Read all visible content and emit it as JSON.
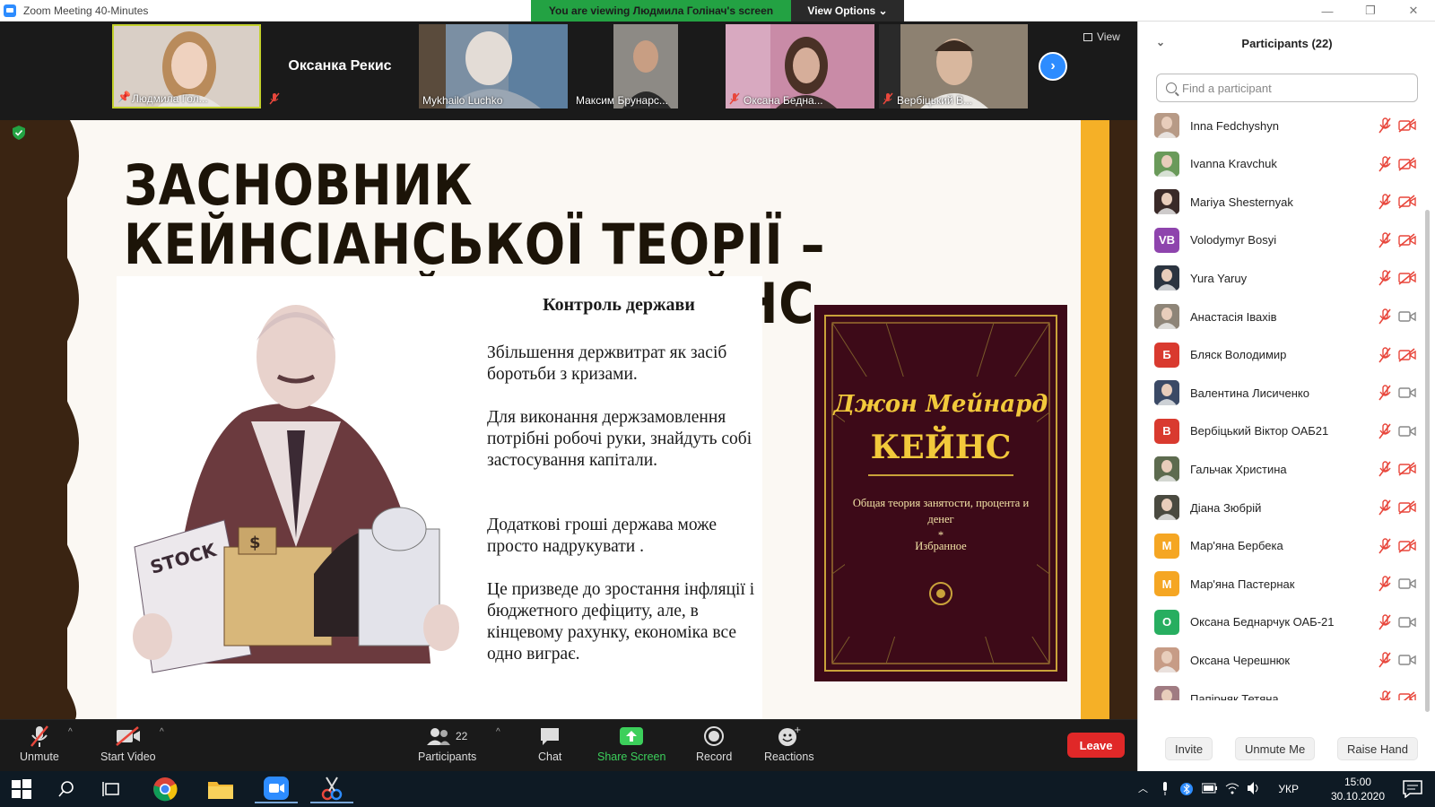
{
  "window": {
    "title": "Zoom Meeting 40-Minutes"
  },
  "banner": {
    "viewing": "You are viewing Людмила Голінач's screen",
    "view_options": "View Options ⌄"
  },
  "view_button": "View",
  "thumbnails": [
    {
      "label": "Людмила Гол...",
      "type": "video"
    },
    {
      "label": "Оксанка Рекис",
      "type": "name"
    },
    {
      "label": "Mykhailo Luchko",
      "type": "video"
    },
    {
      "label": "Максим Брунарс...",
      "type": "video"
    },
    {
      "label": "Оксана Бедна...",
      "type": "video"
    },
    {
      "label": "Вербіцький В...",
      "type": "video"
    }
  ],
  "slide": {
    "title_line1": "ЗАСНОВНИК КЕЙНСІАНСЬКОЇ ТЕОРІЇ –",
    "title_line2": "ДЖОН МЕЙНАРД КЕЙНС",
    "illustration_text": {
      "stock": "STOCK",
      "dollar": "$"
    },
    "heading": "Контроль держави",
    "paragraphs": [
      "Збільшення держвитрат як засіб боротьби з кризами.",
      "Для виконання держзамовлення потрібні робочі руки, знайдуть собі застосування капітали.",
      "Додаткові гроші держава може просто надрукувати .",
      "Це призведе до зростання інфляції і бюджетного дефіциту, але, в кінцевому рахунку, економіка все одно виграє."
    ],
    "book": {
      "author_line1": "Джон Мейнард",
      "author_line2": "КЕЙНС",
      "subtitle": "Общая теория занятости, процента и денег",
      "star": "*",
      "selected": "Избранное"
    }
  },
  "toolbar": {
    "unmute": "Unmute",
    "start_video": "Start Video",
    "participants": "Participants",
    "participants_count": "22",
    "chat": "Chat",
    "share_screen": "Share Screen",
    "record": "Record",
    "reactions": "Reactions",
    "leave": "Leave"
  },
  "panel": {
    "title": "Participants (22)",
    "search_placeholder": "Find a participant",
    "participants": [
      {
        "name": "Inna Fedchyshyn",
        "avatar": "photo",
        "color": "#b79a86",
        "video_on": false
      },
      {
        "name": "Ivanna Kravchuk",
        "avatar": "photo",
        "color": "#6a9a5a",
        "video_on": false
      },
      {
        "name": "Mariya Shesternyak",
        "avatar": "photo",
        "color": "#3a2a28",
        "video_on": false
      },
      {
        "name": "Volodymyr Bosyi",
        "avatar": "VB",
        "color": "#8e44ad",
        "video_on": false
      },
      {
        "name": "Yura Yaruy",
        "avatar": "photo",
        "color": "#2b3440",
        "video_on": false
      },
      {
        "name": "Анастасія Іваxів",
        "avatar": "photo",
        "color": "#8e8578",
        "video_on": true
      },
      {
        "name": "Бляск Володимир",
        "avatar": "Б",
        "color": "#d93a2f",
        "video_on": false
      },
      {
        "name": "Валентина Лисиченко",
        "avatar": "photo",
        "color": "#3b4a66",
        "video_on": true
      },
      {
        "name": "Вербіцький Віктор ОАБ21",
        "avatar": "В",
        "color": "#d93a2f",
        "video_on": true
      },
      {
        "name": "Гальчак Христина",
        "avatar": "photo",
        "color": "#5d6b4f",
        "video_on": false
      },
      {
        "name": "Діана Зюбрій",
        "avatar": "photo",
        "color": "#4a4a40",
        "video_on": false
      },
      {
        "name": "Мар'яна Бербека",
        "avatar": "М",
        "color": "#f5a623",
        "video_on": false
      },
      {
        "name": "Мар'яна Пастернак",
        "avatar": "М",
        "color": "#f5a623",
        "video_on": true
      },
      {
        "name": "Оксана Беднарчук ОАБ-21",
        "avatar": "О",
        "color": "#27ae60",
        "video_on": true
      },
      {
        "name": "Оксана Черешнюк",
        "avatar": "photo",
        "color": "#c79c86",
        "video_on": true
      },
      {
        "name": "Папірняк Тетяна",
        "avatar": "photo",
        "color": "#a07b82",
        "video_on": false
      }
    ],
    "invite": "Invite",
    "unmute_me": "Unmute Me",
    "raise_hand": "Raise Hand"
  },
  "taskbar": {
    "lang": "УКР",
    "time": "15:00",
    "date": "30.10.2020"
  },
  "colors": {
    "accent": "#2d8cff",
    "green": "#23a243",
    "leave": "#e02828",
    "mute": "#e8473c"
  }
}
